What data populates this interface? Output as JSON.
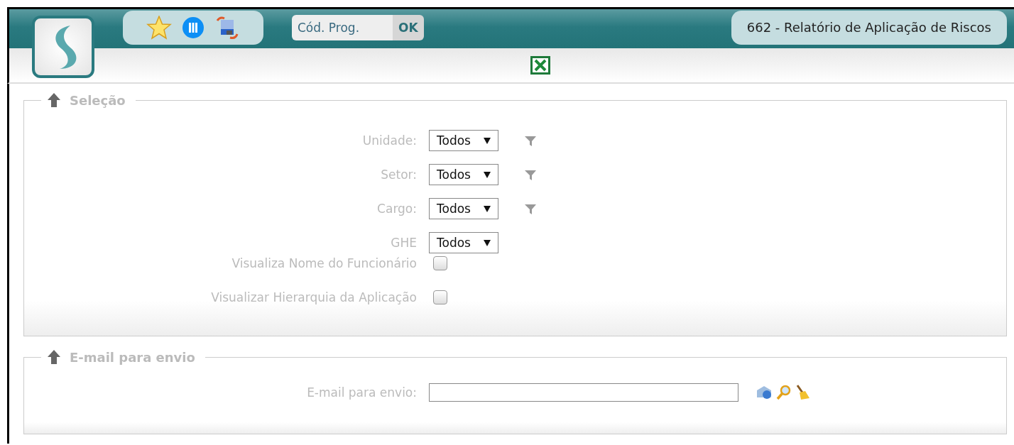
{
  "header": {
    "program_code": {
      "placeholder": "Cód. Prog."
    },
    "ok_button": "OK",
    "title": "662 - Relatório de Aplicação de Riscos"
  },
  "sections": [
    {
      "title": "Seleção",
      "fields": [
        {
          "kind": "select",
          "label": "Unidade:",
          "value": "Todos",
          "filter": true
        },
        {
          "kind": "select",
          "label": "Setor:",
          "value": "Todos",
          "filter": true
        },
        {
          "kind": "select",
          "label": "Cargo:",
          "value": "Todos",
          "filter": true
        },
        {
          "kind": "select",
          "label": "GHE",
          "value": "Todos",
          "filter": false
        },
        {
          "kind": "checkbox",
          "label": "Visualiza Nome do Funcionário",
          "checked": false
        },
        {
          "kind": "checkbox",
          "label": "Visualizar Hierarquia da Aplicação",
          "checked": false
        }
      ]
    },
    {
      "title": "E-mail para envio",
      "fields": [
        {
          "kind": "email",
          "label": "E-mail para envio:"
        }
      ]
    }
  ]
}
